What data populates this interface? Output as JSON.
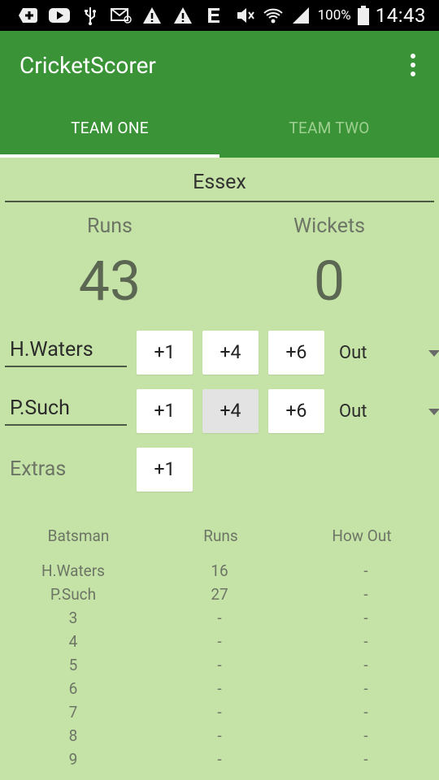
{
  "status_bar": {
    "battery": "100%",
    "time": "14:43",
    "icons": [
      "add-box-icon",
      "youtube-icon",
      "usb-icon",
      "email-icon",
      "warning-icon",
      "warning-icon",
      "e-letter-icon",
      "mute-icon",
      "wifi-icon",
      "signal-icon",
      "battery-icon"
    ]
  },
  "app_bar": {
    "title": "CricketScorer",
    "tabs": [
      "TEAM ONE",
      "TEAM TWO"
    ],
    "selected_tab": 0
  },
  "team": {
    "name": "Essex",
    "runs_label": "Runs",
    "wickets_label": "Wickets",
    "runs": "43",
    "wickets": "0"
  },
  "batsmen_controls": [
    {
      "name": "H.Waters",
      "buttons": [
        "+1",
        "+4",
        "+6"
      ],
      "out_label": "Out"
    },
    {
      "name": "P.Such",
      "buttons": [
        "+1",
        "+4",
        "+6"
      ],
      "out_label": "Out"
    }
  ],
  "extras": {
    "label": "Extras",
    "button": "+1"
  },
  "scorecard": {
    "headers": [
      "Batsman",
      "Runs",
      "How Out"
    ],
    "rows": [
      [
        "H.Waters",
        "16",
        "-"
      ],
      [
        "P.Such",
        "27",
        "-"
      ],
      [
        "3",
        "-",
        "-"
      ],
      [
        "4",
        "-",
        "-"
      ],
      [
        "5",
        "-",
        "-"
      ],
      [
        "6",
        "-",
        "-"
      ],
      [
        "7",
        "-",
        "-"
      ],
      [
        "8",
        "-",
        "-"
      ],
      [
        "9",
        "-",
        "-"
      ]
    ]
  },
  "colors": {
    "app_bar": "#3a9437",
    "background": "#c5e3a6",
    "status_bar": "#000000"
  }
}
